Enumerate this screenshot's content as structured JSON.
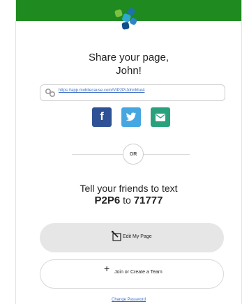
{
  "colors": {
    "topbar": "#1e8a1f",
    "facebook": "#2f5196",
    "twitter": "#46a6e2",
    "email": "#2aa17d",
    "link": "#3a6cc7"
  },
  "header": {
    "logo_icon": "mobilecause-logo-icon"
  },
  "share": {
    "title_line1": "Share your page,",
    "title_line2": "John!",
    "url": "https://app.mobilecause.com/VIP2P/JohnMur4",
    "link_icon": "link-icon",
    "facebook_icon": "facebook-icon",
    "twitter_icon": "twitter-icon",
    "email_icon": "email-icon"
  },
  "divider": {
    "label": "OR"
  },
  "text_to_give": {
    "line1": "Tell your friends to text",
    "keyword": "P2P6",
    "connector": "to",
    "shortcode": "71777"
  },
  "actions": {
    "edit_label": "Edit My Page",
    "edit_icon": "edit-icon",
    "team_label": "Join or Create a Team",
    "team_icon": "plus-icon"
  },
  "footer": {
    "change_password": "Change Password"
  }
}
